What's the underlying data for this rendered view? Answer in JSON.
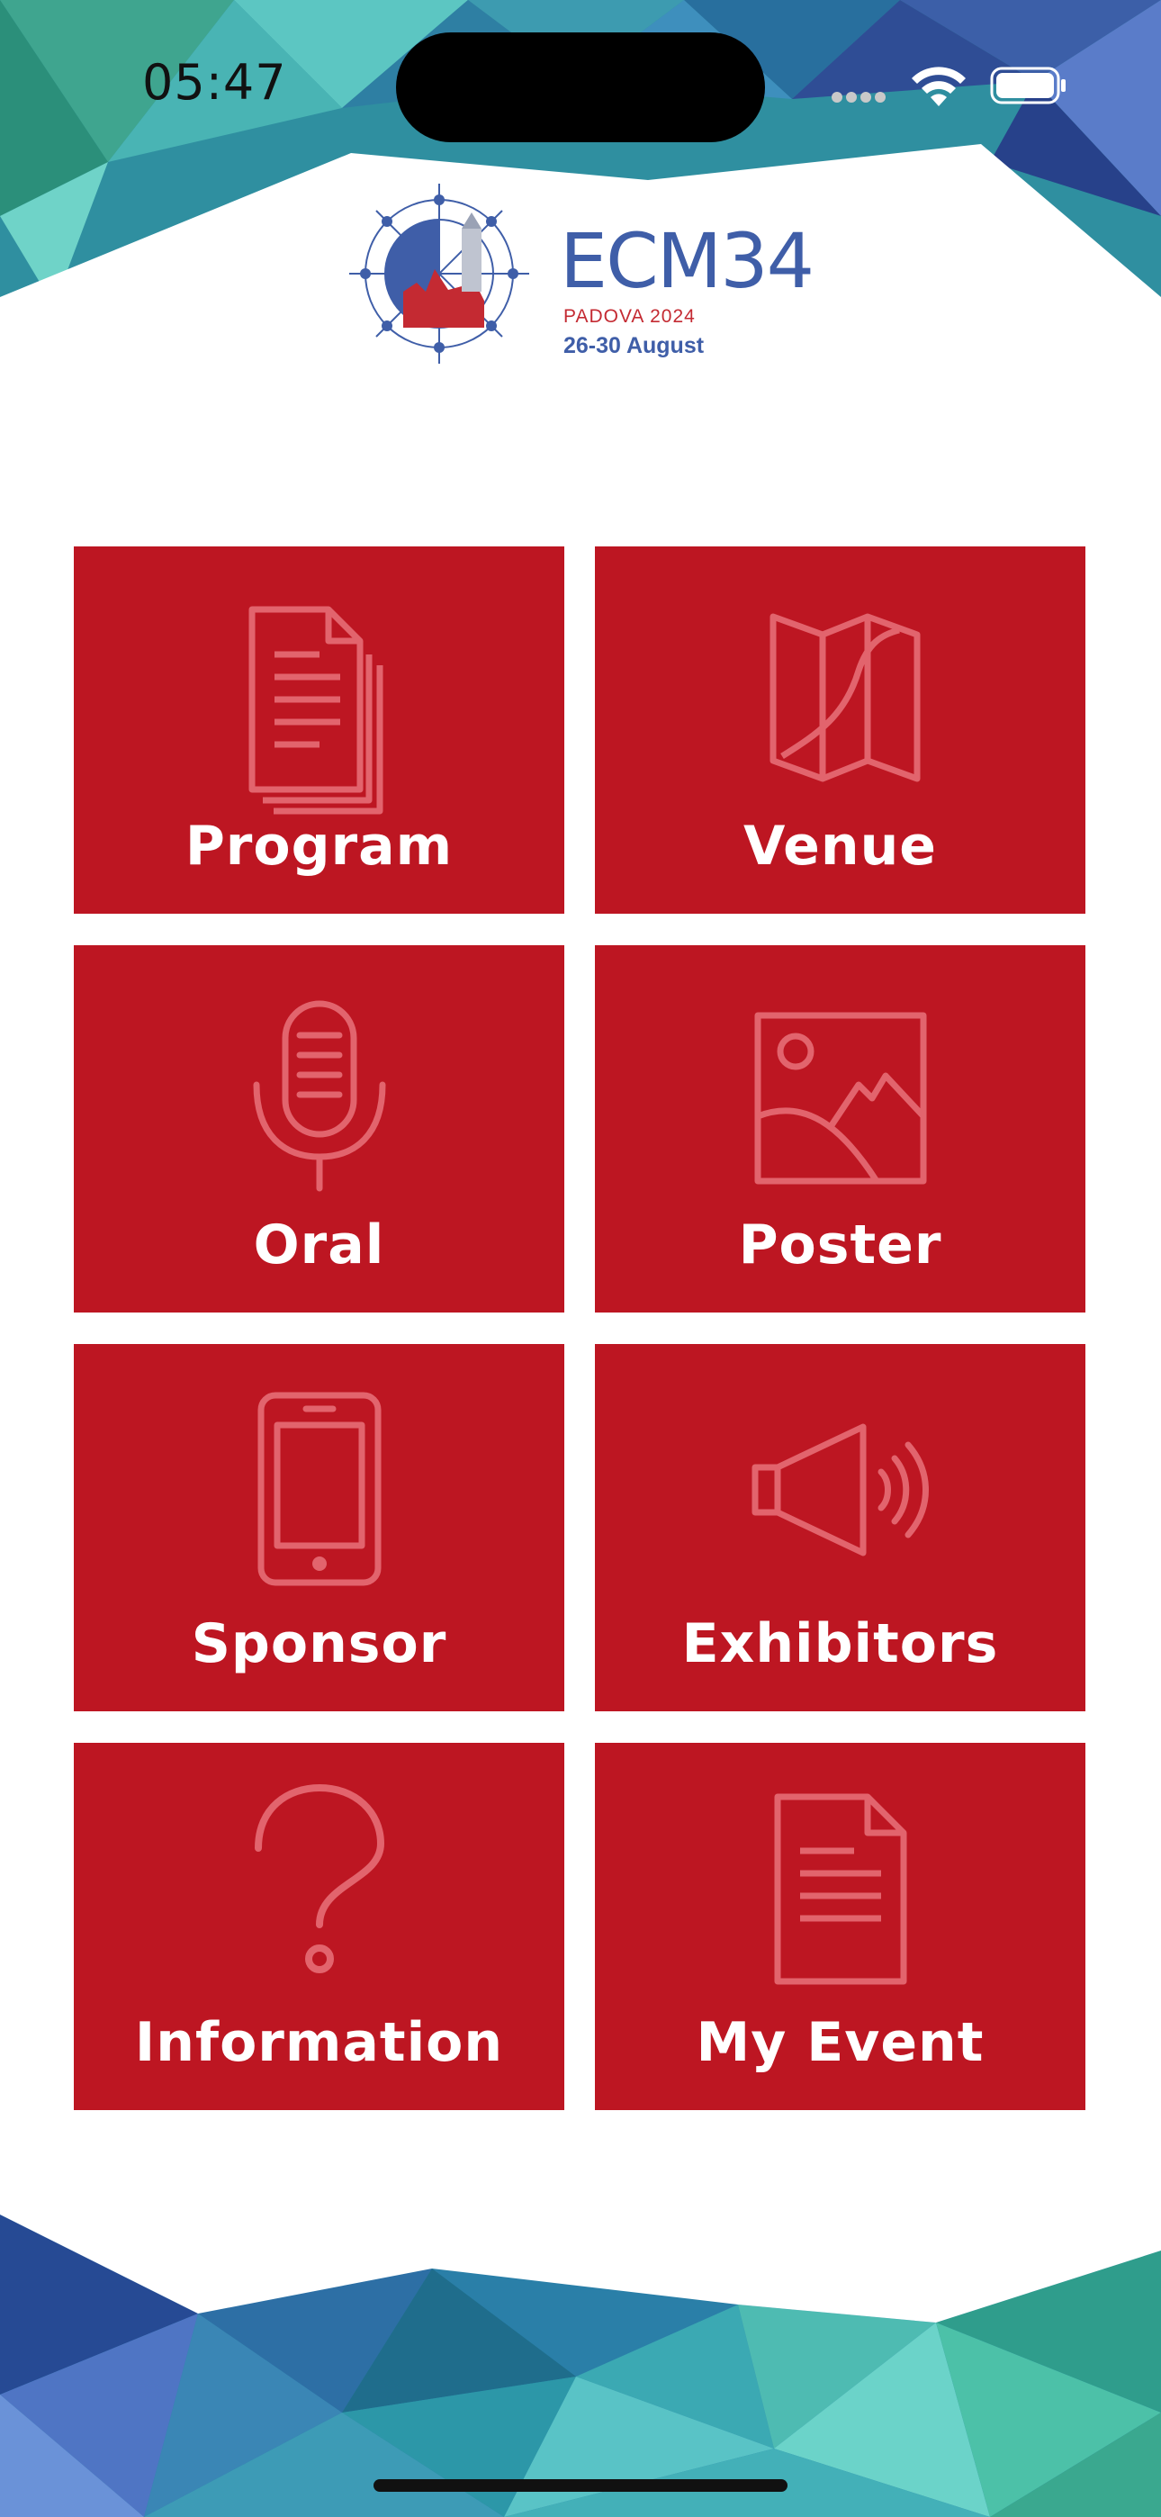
{
  "status_bar": {
    "time": "05:47"
  },
  "logo": {
    "title": "ECM34",
    "location": "PADOVA 2024",
    "dates": "26-30 August"
  },
  "tiles": [
    {
      "label": "Program",
      "icon": "documents-icon"
    },
    {
      "label": "Venue",
      "icon": "map-icon"
    },
    {
      "label": "Oral",
      "icon": "microphone-icon"
    },
    {
      "label": "Poster",
      "icon": "image-icon"
    },
    {
      "label": "Sponsor",
      "icon": "smartphone-icon"
    },
    {
      "label": "Exhibitors",
      "icon": "megaphone-icon"
    },
    {
      "label": "Information",
      "icon": "question-icon"
    },
    {
      "label": "My Event",
      "icon": "document-icon"
    }
  ],
  "colors": {
    "tile": "#bd1622",
    "icon_stroke": "#e2646d",
    "brand_blue": "#3f5ea8",
    "brand_red": "#c42a32"
  }
}
